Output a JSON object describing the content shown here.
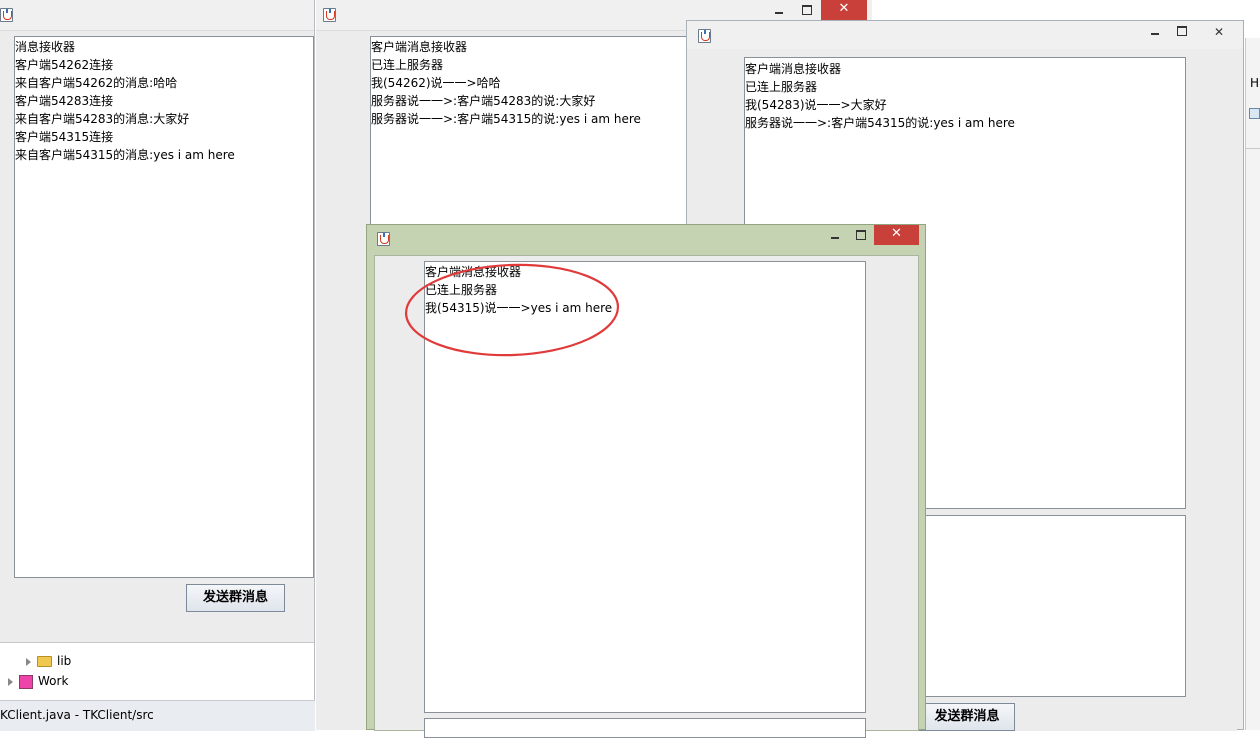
{
  "server_window": {
    "log_lines": [
      "消息接收器",
      "客户端54262连接",
      "来自客户端54262的消息:哈哈",
      "客户端54283连接",
      "来自客户端54283的消息:大家好",
      "客户端54315连接",
      "来自客户端54315的消息:yes i am here"
    ],
    "send_button": "发送群消息"
  },
  "client_window_1": {
    "lines": [
      "客户端消息接收器",
      "已连上服务器",
      "我(54262)说一一>哈哈",
      "服务器说一一>:客户端54283的说:大家好",
      "服务器说一一>:客户端54315的说:yes i am here"
    ]
  },
  "client_window_2": {
    "lines": [
      "客户端消息接收器",
      "已连上服务器",
      "我(54283)说一一>大家好",
      "服务器说一一>:客户端54315的说:yes i am here"
    ],
    "send_button": "发送群消息"
  },
  "client_window_3": {
    "lines": [
      "客户端消息接收器",
      "已连上服务器",
      "我(54315)说一一>yes i am here"
    ]
  },
  "window_controls": {
    "minimize": "—",
    "maximize": "☐",
    "close": "✕"
  },
  "project_tree": {
    "lib": "lib",
    "work": "Work"
  },
  "status_bar": {
    "text": "KClient.java - TKClient/src"
  },
  "right_edge_text": "H",
  "annotation_color": "#e03a3a"
}
